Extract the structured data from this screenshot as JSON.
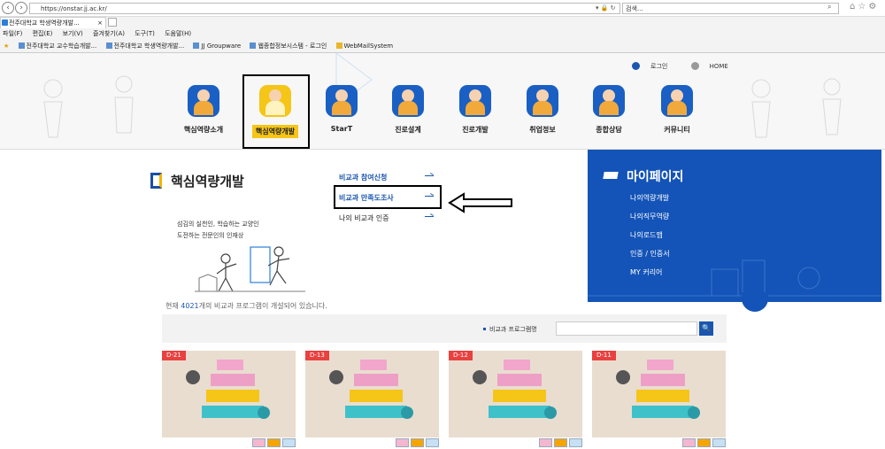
{
  "browser": {
    "url": "https://onstar.jj.ac.kr/",
    "addr_icons": "▾ 🔒 ↻",
    "search_placeholder": "검색...",
    "tab_title": "전주대학교 학생역량개발...",
    "menu": [
      "파일(F)",
      "편집(E)",
      "보기(V)",
      "즐겨찾기(A)",
      "도구(T)",
      "도움말(H)"
    ],
    "favorites": [
      "전주대학교 교수학습개발...",
      "전주대학교 학생역량개발...",
      "JJ Groupware",
      "웹종합정보시스템 - 로그인",
      "WebMailSystem"
    ]
  },
  "header": {
    "login": "로그인",
    "home": "HOME",
    "gnb": [
      {
        "label": "핵심역량소개"
      },
      {
        "label": "핵심역량개발"
      },
      {
        "label": "StarT"
      },
      {
        "label": "진로설계"
      },
      {
        "label": "진로개발"
      },
      {
        "label": "취업정보"
      },
      {
        "label": "종합상담"
      },
      {
        "label": "커뮤니티"
      }
    ]
  },
  "panel": {
    "title": "핵심역량개발",
    "desc_line1": "섬김의 실천인, 학습하는 교양인",
    "desc_line2": "도전하는 전문인의 인재상",
    "menu": [
      "비교과 참여신청",
      "비교과 만족도조사",
      "나의 비교과 인증"
    ]
  },
  "mypage": {
    "title": "마이페이지",
    "items": [
      "나의역량개발",
      "나의직무역량",
      "나의로드맵",
      "인증 / 인증서",
      "MY 커리어"
    ]
  },
  "content": {
    "notice_prefix": "현재 ",
    "notice_num": "4021",
    "notice_suffix": "개의 비교과 프로그램이 개설되어 있습니다.",
    "search_label": "비교과 프로그램명",
    "search_btn": "🔍",
    "cards": [
      {
        "dday": "D-21"
      },
      {
        "dday": "D-13"
      },
      {
        "dday": "D-12"
      },
      {
        "dday": "D-11"
      }
    ]
  }
}
